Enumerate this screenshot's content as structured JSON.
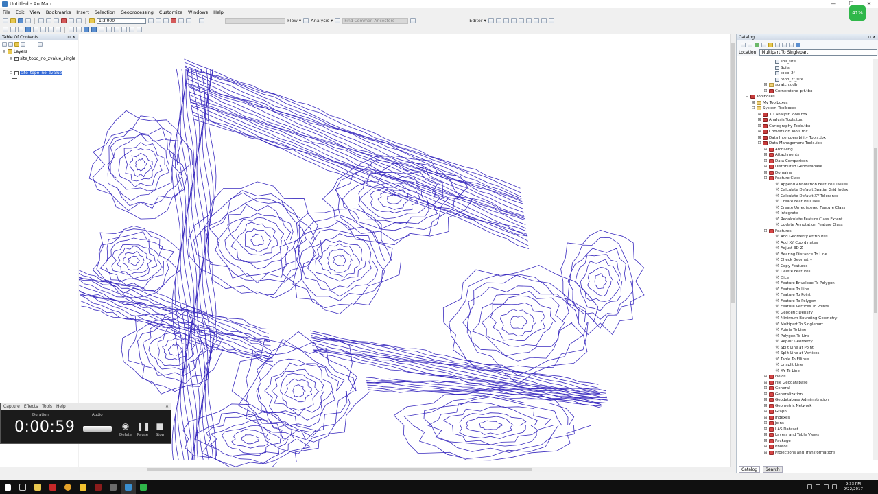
{
  "window": {
    "title": "Untitled - ArcMap",
    "minimize": "—",
    "maximize": "☐",
    "close": "✕"
  },
  "menu": [
    "File",
    "Edit",
    "View",
    "Bookmarks",
    "Insert",
    "Selection",
    "Geoprocessing",
    "Customize",
    "Windows",
    "Help"
  ],
  "toolbar": {
    "scale": "1:3,000",
    "flow_label": "Flow ▾",
    "analysis_label": "Analysis ▾",
    "find_ancestors_placeholder": "Find Common Ancestors",
    "editor_label": "Editor ▾"
  },
  "toc": {
    "title": "Table Of Contents",
    "layers_label": "Layers",
    "items": [
      {
        "label": "site_topo_no_zvalue_single",
        "checked": true
      },
      {
        "label": "site_topo_no_zvalue",
        "checked": false,
        "selected": true
      }
    ]
  },
  "catalog": {
    "title": "Catalog",
    "location_label": "Location:",
    "location_value": "Multipart To Singlepart",
    "tabs": [
      "Catalog",
      "Search"
    ],
    "tree": [
      {
        "level": 5,
        "icon": "file",
        "label": "soil_site"
      },
      {
        "level": 5,
        "icon": "file",
        "label": "Soils"
      },
      {
        "level": 5,
        "icon": "file",
        "label": "topo_2f"
      },
      {
        "level": 5,
        "icon": "file",
        "label": "topo_2f_site"
      },
      {
        "level": 4,
        "icon": "folder",
        "exp": "⊞",
        "label": "scratch.gdb"
      },
      {
        "level": 4,
        "icon": "tbx",
        "exp": "⊞",
        "label": "Cornerstone_pjt.tbx"
      },
      {
        "level": 1,
        "icon": "tbx",
        "exp": "⊟",
        "label": "Toolboxes"
      },
      {
        "level": 2,
        "icon": "folder",
        "exp": "⊞",
        "label": "My Toolboxes"
      },
      {
        "level": 2,
        "icon": "folder",
        "exp": "⊟",
        "label": "System Toolboxes"
      },
      {
        "level": 3,
        "icon": "tbx",
        "exp": "⊞",
        "label": "3D Analyst Tools.tbx"
      },
      {
        "level": 3,
        "icon": "tbx",
        "exp": "⊞",
        "label": "Analysis Tools.tbx"
      },
      {
        "level": 3,
        "icon": "tbx",
        "exp": "⊞",
        "label": "Cartography Tools.tbx"
      },
      {
        "level": 3,
        "icon": "tbx",
        "exp": "⊞",
        "label": "Conversion Tools.tbx"
      },
      {
        "level": 3,
        "icon": "tbx",
        "exp": "⊞",
        "label": "Data Interoperability Tools.tbx"
      },
      {
        "level": 3,
        "icon": "tbx",
        "exp": "⊟",
        "label": "Data Management Tools.tbx"
      },
      {
        "level": 4,
        "icon": "set",
        "exp": "⊞",
        "label": "Archiving"
      },
      {
        "level": 4,
        "icon": "set",
        "exp": "⊞",
        "label": "Attachments"
      },
      {
        "level": 4,
        "icon": "set",
        "exp": "⊞",
        "label": "Data Comparison"
      },
      {
        "level": 4,
        "icon": "set",
        "exp": "⊞",
        "label": "Distributed Geodatabase"
      },
      {
        "level": 4,
        "icon": "set",
        "exp": "⊞",
        "label": "Domains"
      },
      {
        "level": 4,
        "icon": "set",
        "exp": "⊟",
        "label": "Feature Class"
      },
      {
        "level": 5,
        "icon": "tool",
        "label": "Append Annotation Feature Classes"
      },
      {
        "level": 5,
        "icon": "tool",
        "label": "Calculate Default Spatial Grid Index"
      },
      {
        "level": 5,
        "icon": "tool",
        "label": "Calculate Default XY Tolerance"
      },
      {
        "level": 5,
        "icon": "tool",
        "label": "Create Feature Class"
      },
      {
        "level": 5,
        "icon": "tool",
        "label": "Create Unregistered Feature Class"
      },
      {
        "level": 5,
        "icon": "tool",
        "label": "Integrate"
      },
      {
        "level": 5,
        "icon": "tool",
        "label": "Recalculate Feature Class Extent"
      },
      {
        "level": 5,
        "icon": "tool",
        "label": "Update Annotation Feature Class"
      },
      {
        "level": 4,
        "icon": "set",
        "exp": "⊟",
        "label": "Features"
      },
      {
        "level": 5,
        "icon": "tool",
        "label": "Add Geometry Attributes"
      },
      {
        "level": 5,
        "icon": "tool",
        "label": "Add XY Coordinates"
      },
      {
        "level": 5,
        "icon": "tool",
        "label": "Adjust 3D Z"
      },
      {
        "level": 5,
        "icon": "tool",
        "label": "Bearing Distance To Line"
      },
      {
        "level": 5,
        "icon": "tool",
        "label": "Check Geometry"
      },
      {
        "level": 5,
        "icon": "tool",
        "label": "Copy Features"
      },
      {
        "level": 5,
        "icon": "tool",
        "label": "Delete Features"
      },
      {
        "level": 5,
        "icon": "tool",
        "label": "Dice"
      },
      {
        "level": 5,
        "icon": "tool",
        "label": "Feature Envelope To Polygon"
      },
      {
        "level": 5,
        "icon": "tool",
        "label": "Feature To Line"
      },
      {
        "level": 5,
        "icon": "tool",
        "label": "Feature To Point"
      },
      {
        "level": 5,
        "icon": "tool",
        "label": "Feature To Polygon"
      },
      {
        "level": 5,
        "icon": "tool",
        "label": "Feature Vertices To Points"
      },
      {
        "level": 5,
        "icon": "tool",
        "label": "Geodetic Densify"
      },
      {
        "level": 5,
        "icon": "tool",
        "label": "Minimum Bounding Geometry"
      },
      {
        "level": 5,
        "icon": "tool",
        "label": "Multipart To Singlepart"
      },
      {
        "level": 5,
        "icon": "tool",
        "label": "Points To Line"
      },
      {
        "level": 5,
        "icon": "tool",
        "label": "Polygon To Line"
      },
      {
        "level": 5,
        "icon": "tool",
        "label": "Repair Geometry"
      },
      {
        "level": 5,
        "icon": "tool",
        "label": "Split Line at Point"
      },
      {
        "level": 5,
        "icon": "tool",
        "label": "Split Line at Vertices"
      },
      {
        "level": 5,
        "icon": "tool",
        "label": "Table To Ellipse"
      },
      {
        "level": 5,
        "icon": "tool",
        "label": "Unsplit Line"
      },
      {
        "level": 5,
        "icon": "tool",
        "label": "XY To Line"
      },
      {
        "level": 4,
        "icon": "set",
        "exp": "⊞",
        "label": "Fields"
      },
      {
        "level": 4,
        "icon": "set",
        "exp": "⊞",
        "label": "File Geodatabase"
      },
      {
        "level": 4,
        "icon": "set",
        "exp": "⊞",
        "label": "General"
      },
      {
        "level": 4,
        "icon": "set",
        "exp": "⊞",
        "label": "Generalization"
      },
      {
        "level": 4,
        "icon": "set",
        "exp": "⊞",
        "label": "Geodatabase Administration"
      },
      {
        "level": 4,
        "icon": "set",
        "exp": "⊞",
        "label": "Geometric Network"
      },
      {
        "level": 4,
        "icon": "set",
        "exp": "⊞",
        "label": "Graph"
      },
      {
        "level": 4,
        "icon": "set",
        "exp": "⊞",
        "label": "Indexes"
      },
      {
        "level": 4,
        "icon": "set",
        "exp": "⊞",
        "label": "Joins"
      },
      {
        "level": 4,
        "icon": "set",
        "exp": "⊞",
        "label": "LAS Dataset"
      },
      {
        "level": 4,
        "icon": "set",
        "exp": "⊞",
        "label": "Layers and Table Views"
      },
      {
        "level": 4,
        "icon": "set",
        "exp": "⊞",
        "label": "Package"
      },
      {
        "level": 4,
        "icon": "set",
        "exp": "⊞",
        "label": "Photos"
      },
      {
        "level": 4,
        "icon": "set",
        "exp": "⊞",
        "label": "Projections and Transformations"
      }
    ]
  },
  "recorder": {
    "menu": [
      "Capture",
      "Effects",
      "Tools",
      "Help"
    ],
    "duration_label": "Duration",
    "audio_label": "Audio",
    "time": "0:00:59",
    "delete_label": "Delete",
    "pause_label": "Pause",
    "stop_label": "Stop"
  },
  "overlay_badge": "41%",
  "taskbar": {
    "time": "9:33 PM",
    "date": "9/22/2017"
  },
  "colors": {
    "contour": "#3a2bbf",
    "selection": "#3369d6",
    "accent_green": "#2fb74a"
  }
}
